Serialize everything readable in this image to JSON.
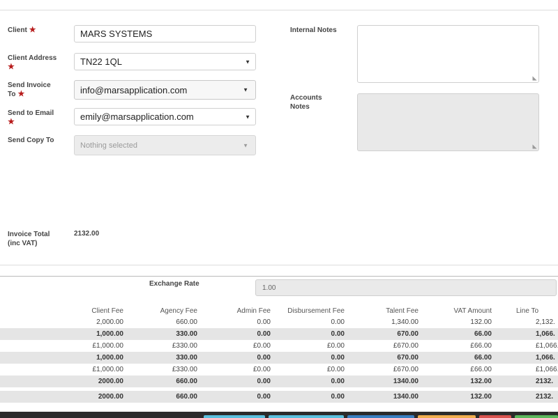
{
  "form": {
    "client_label": "Client",
    "client_value": "MARS SYSTEMS",
    "client_address_label": "Client Address",
    "client_address_value": "TN22 1QL",
    "send_invoice_to_label": "Send Invoice To",
    "send_invoice_to_value": "info@marsapplication.com",
    "send_to_email_label": "Send to Email",
    "send_to_email_value": "emily@marsapplication.com",
    "send_copy_to_label": "Send Copy To",
    "send_copy_to_placeholder": "Nothing selected",
    "internal_notes_label": "Internal Notes",
    "accounts_notes_label": "Accounts Notes",
    "invoice_total_label": "Invoice Total (inc VAT)",
    "invoice_total_value": "2132.00",
    "required_marker": "★"
  },
  "exchange": {
    "label": "Exchange Rate",
    "value": "1.00"
  },
  "fees_table": {
    "columns": [
      "Client Fee",
      "Agency Fee",
      "Admin Fee",
      "Disbursement Fee",
      "Talent Fee",
      "VAT Amount",
      "Line To"
    ],
    "rows": [
      {
        "style": "plain",
        "cells": [
          "2,000.00",
          "660.00",
          "0.00",
          "0.00",
          "1,340.00",
          "132.00",
          "2,132."
        ]
      },
      {
        "style": "bold",
        "cells": [
          "1,000.00",
          "330.00",
          "0.00",
          "0.00",
          "670.00",
          "66.00",
          "1,066."
        ]
      },
      {
        "style": "plain",
        "cells": [
          "£1,000.00",
          "£330.00",
          "£0.00",
          "£0.00",
          "£670.00",
          "£66.00",
          "£1,066."
        ]
      },
      {
        "style": "bold",
        "cells": [
          "1,000.00",
          "330.00",
          "0.00",
          "0.00",
          "670.00",
          "66.00",
          "1,066."
        ]
      },
      {
        "style": "plain",
        "cells": [
          "£1,000.00",
          "£330.00",
          "£0.00",
          "£0.00",
          "£670.00",
          "£66.00",
          "£1,066."
        ]
      },
      {
        "style": "total",
        "cells": [
          "2000.00",
          "660.00",
          "0.00",
          "0.00",
          "1340.00",
          "132.00",
          "2132."
        ]
      },
      {
        "style": "total",
        "cells": [
          "2000.00",
          "660.00",
          "0.00",
          "0.00",
          "1340.00",
          "132.00",
          "2132."
        ]
      }
    ]
  },
  "icons": {
    "caret": "caret-down-icon",
    "resize": "resize-handle-icon",
    "required": "required-star-icon"
  },
  "colors": {
    "required_star": "#b71c1c",
    "footer_bar": "#2b2b2b",
    "btn_light_blue": "#5bc0de",
    "btn_blue": "#3a7fc1",
    "btn_orange": "#f0ad4e",
    "btn_red": "#d9534f",
    "btn_green": "#5cb85c"
  }
}
